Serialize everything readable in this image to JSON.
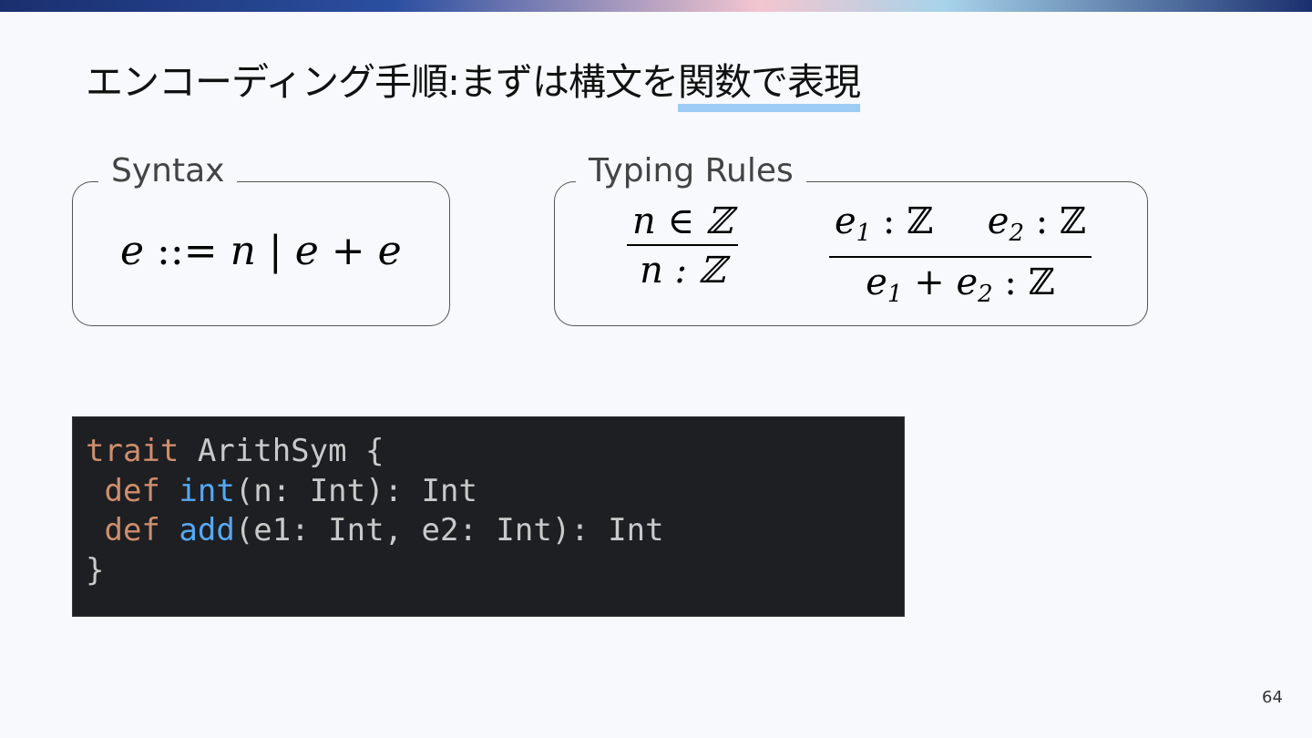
{
  "slide": {
    "title_main": "エンコーディング手順:まずは構文を",
    "title_highlight": "関数で表現",
    "page_number": "64"
  },
  "syntax_box": {
    "label": "Syntax",
    "grammar": {
      "lhs": "e",
      "def": "::=",
      "alt1": "n",
      "sep": "|",
      "alt2_left": "e",
      "plus": "+",
      "alt2_right": "e"
    }
  },
  "typing_box": {
    "label": "Typing Rules",
    "rule_int": {
      "premise": "n ∈ ℤ",
      "conclusion": "n : ℤ"
    },
    "rule_add": {
      "premise1_var": "e",
      "premise1_sub": "1",
      "premise1_type": " : ℤ",
      "premise2_var": "e",
      "premise2_sub": "2",
      "premise2_type": " : ℤ",
      "concl_var1": "e",
      "concl_sub1": "1",
      "concl_plus": " + ",
      "concl_var2": "e",
      "concl_sub2": "2",
      "concl_type": " : ℤ"
    }
  },
  "code_block": {
    "line1": {
      "kw": "trait",
      "rest": " ArithSym {"
    },
    "line2": {
      "indent": " ",
      "kw": "def",
      "sp": " ",
      "fn": "int",
      "rest": "(n: Int): Int"
    },
    "line3": {
      "indent": " ",
      "kw": "def",
      "sp": " ",
      "fn": "add",
      "rest": "(e1: Int, e2: Int): Int"
    },
    "line4": {
      "rest": "}"
    },
    "colors": {
      "keyword": "#cf8e6d",
      "function": "#56a8f5",
      "text": "#c9c9c9",
      "background": "#1e1f22"
    }
  }
}
